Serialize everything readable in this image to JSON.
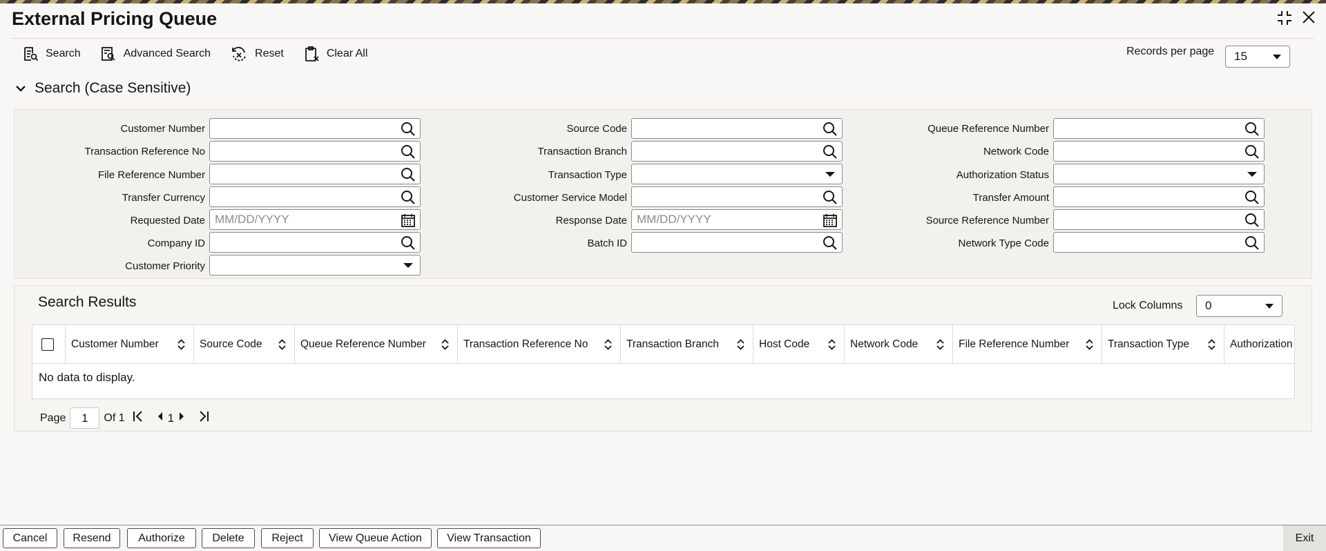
{
  "window": {
    "title": "External Pricing Queue"
  },
  "toolbar": {
    "search": "Search",
    "advanced_search": "Advanced Search",
    "reset": "Reset",
    "clear_all": "Clear All"
  },
  "records_per_page": {
    "label": "Records per page",
    "value": "15"
  },
  "search_section": {
    "title": "Search (Case Sensitive)"
  },
  "fields": {
    "customer_number": {
      "label": "Customer Number",
      "value": ""
    },
    "transaction_reference_no": {
      "label": "Transaction Reference No",
      "value": ""
    },
    "file_reference_number": {
      "label": "File Reference Number",
      "value": ""
    },
    "transfer_currency": {
      "label": "Transfer Currency",
      "value": ""
    },
    "requested_date": {
      "label": "Requested Date",
      "placeholder": "MM/DD/YYYY"
    },
    "company_id": {
      "label": "Company ID",
      "value": ""
    },
    "customer_priority": {
      "label": "Customer Priority",
      "value": ""
    },
    "source_code": {
      "label": "Source Code",
      "value": ""
    },
    "transaction_branch": {
      "label": "Transaction Branch",
      "value": ""
    },
    "transaction_type": {
      "label": "Transaction Type",
      "value": ""
    },
    "customer_service_model": {
      "label": "Customer Service Model",
      "value": ""
    },
    "response_date": {
      "label": "Response Date",
      "placeholder": "MM/DD/YYYY"
    },
    "batch_id": {
      "label": "Batch ID",
      "value": ""
    },
    "queue_reference_number": {
      "label": "Queue Reference Number",
      "value": ""
    },
    "network_code": {
      "label": "Network Code",
      "value": ""
    },
    "authorization_status": {
      "label": "Authorization Status",
      "value": ""
    },
    "transfer_amount": {
      "label": "Transfer Amount",
      "value": ""
    },
    "source_reference_number": {
      "label": "Source Reference Number",
      "value": ""
    },
    "network_type_code": {
      "label": "Network Type Code",
      "value": ""
    }
  },
  "results": {
    "title": "Search Results",
    "lock_columns_label": "Lock Columns",
    "lock_columns_value": "0",
    "columns": [
      "Customer Number",
      "Source Code",
      "Queue Reference Number",
      "Transaction Reference No",
      "Transaction Branch",
      "Host Code",
      "Network Code",
      "File Reference Number",
      "Transaction Type",
      "Authorization"
    ],
    "empty_message": "No data to display."
  },
  "pagination": {
    "page_label": "Page",
    "page_value": "1",
    "of_label": "Of 1",
    "current": "1"
  },
  "footer": {
    "buttons": [
      "Cancel",
      "Resend",
      "Authorize",
      "Delete",
      "Reject",
      "View Queue Action",
      "View Transaction"
    ],
    "exit": "Exit"
  }
}
